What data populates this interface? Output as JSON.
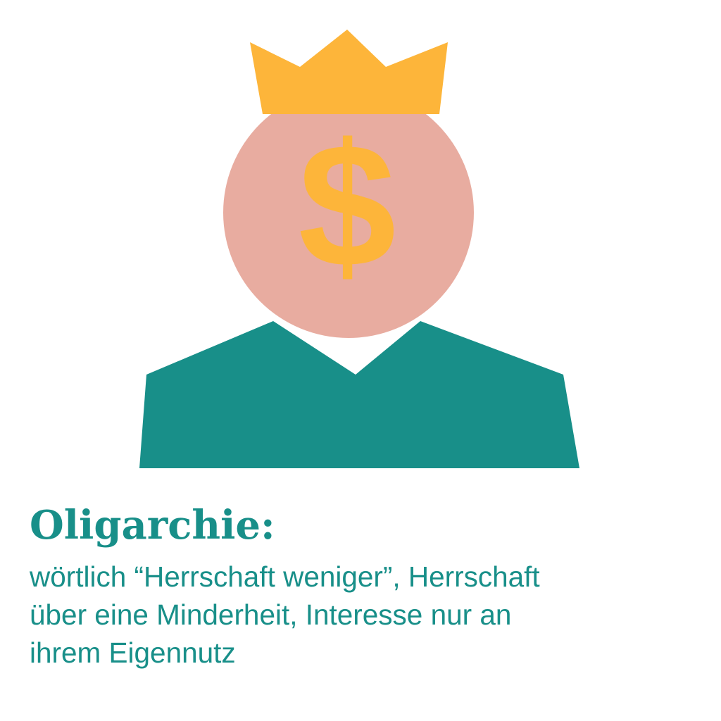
{
  "colors": {
    "crown": "#fdb53a",
    "face": "#e8aca0",
    "body": "#188f89",
    "dollar": "#fdb53a",
    "text": "#188f89",
    "background": "#ffffff"
  },
  "icons": {
    "crown": "crown-icon",
    "face": "face-circle",
    "dollar": "dollar-sign-icon",
    "body": "shoulders-shape"
  },
  "illustration": {
    "dollar_symbol": "$"
  },
  "caption": {
    "term": "Oligarchie:",
    "definition_lines": [
      "wörtlich “Herrschaft weniger”, Herrschaft",
      "über eine Minderheit, Interesse nur an",
      "ihrem Eigennutz"
    ]
  }
}
